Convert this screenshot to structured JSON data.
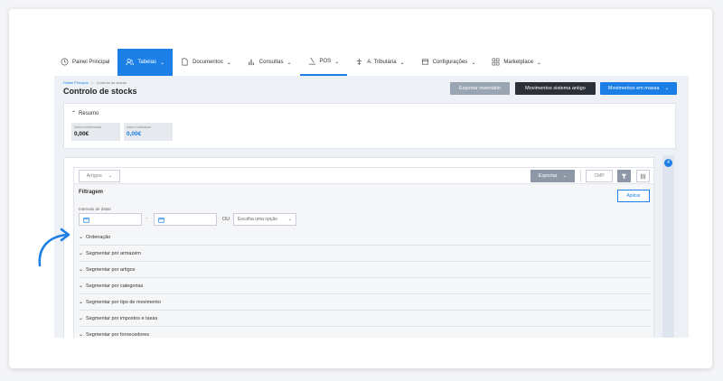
{
  "nav": {
    "items": [
      {
        "label": "Painel Principal",
        "icon": "clock-icon"
      },
      {
        "label": "Tabelas",
        "icon": "users-icon",
        "dropdown": true,
        "active": true
      },
      {
        "label": "Documentos",
        "icon": "document-icon",
        "dropdown": true
      },
      {
        "label": "Consultas",
        "icon": "bar-chart-icon",
        "dropdown": true
      },
      {
        "label": "POS",
        "icon": "pos-icon",
        "dropdown": true
      },
      {
        "label": "A. Tributária",
        "icon": "tax-icon",
        "dropdown": true
      },
      {
        "label": "Configurações",
        "icon": "settings-icon",
        "dropdown": true
      },
      {
        "label": "Marketplace",
        "icon": "marketplace-icon",
        "dropdown": true
      }
    ]
  },
  "breadcrumb": {
    "home": "Painel Principal",
    "sep": "/",
    "current": "Controlo de stocks"
  },
  "page": {
    "title": "Controlo de stocks"
  },
  "actions": {
    "export_inventory": "Exportar inventário",
    "old_movements": "Movimentos sistema antigo",
    "bulk_movements": "Movimentos em massa"
  },
  "resumo": {
    "title": "Resumo",
    "stats": [
      {
        "label": "Valor existências",
        "value": "0,00€"
      },
      {
        "label": "Valor realizável",
        "value": "0,00€"
      }
    ]
  },
  "toolbar": {
    "artigos": "Artigos",
    "exportar": "Exportar",
    "chip": "CMP"
  },
  "filters": {
    "title": "Filtragem",
    "apply": "Aplicar",
    "interval_label": "Intervalo de datas",
    "date_sep": "-",
    "or": "OU",
    "choose_placeholder": "Escolha uma opção",
    "sections": [
      "Ordenação",
      "Segmentar por armazém",
      "Segmentar por artigos",
      "Segmentar por categorias",
      "Segmentar por tipo de movimento",
      "Segmentar por impostos e taxas",
      "Segmentar por fornecedores"
    ]
  },
  "scroll": {
    "badge": "4"
  },
  "colors": {
    "primary": "#1b7fe5",
    "dark": "#2c3038",
    "muted": "#9aa5b4"
  }
}
